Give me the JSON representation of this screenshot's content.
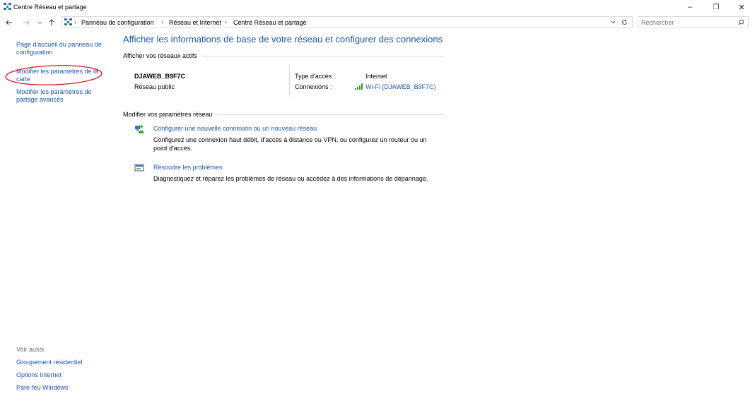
{
  "window": {
    "title": "Centre Réseau et partage",
    "minimize_glyph": "–",
    "restore_glyph": "❐",
    "close_glyph": "✕"
  },
  "nav": {
    "back_icon": "arrow-left-icon",
    "forward_icon": "arrow-right-icon",
    "recent_icon": "chevron-down-icon",
    "up_icon": "arrow-up-icon",
    "breadcrumbs": [
      "Panneau de configuration",
      "Réseau et Internet",
      "Centre Réseau et partage"
    ],
    "separator": "›",
    "search_placeholder": "Rechercher"
  },
  "sidebar": {
    "links": [
      {
        "line1": "Page d'accueil du panneau de",
        "line2": "configuration"
      },
      {
        "line1": "Modifier les paramètres de la",
        "line2": "carte"
      },
      {
        "line1": "Modifier les paramètres de",
        "line2": "partage avancés"
      }
    ],
    "see_also_title": "Voir aussi",
    "see_also": [
      "Groupement résidentiel",
      "Options Internet",
      "Pare-feu Windows"
    ],
    "highlight_color": "#d9141d"
  },
  "main": {
    "title": "Afficher les informations de base de votre réseau et configurer des connexions",
    "active_networks_header": "Afficher vos réseaux actifs",
    "network": {
      "name": "DJAWEB_B9F7C",
      "type": "Réseau public",
      "access_type_label": "Type d'accès :",
      "access_type_value": "Internet",
      "connections_label": "Connexions :",
      "connections_value": "Wi-Fi (DJAWEB_B9F7C)"
    },
    "modify_header": "Modifier vos paramètres réseau",
    "tasks": [
      {
        "icon": "new-connection-icon",
        "title": "Configurer une nouvelle connexion ou un nouveau réseau",
        "desc_line1": "Configurez une connexion haut débit, d'accès à distance ou VPN, ou configurez un routeur ou un",
        "desc_line2": "point d'accès."
      },
      {
        "icon": "troubleshoot-icon",
        "title": "Résoudre les problèmes",
        "desc_line1": "Diagnostiquez et réparez les problèmes de réseau ou accédez à des informations de dépannage."
      }
    ]
  },
  "colors": {
    "link": "#1a56b4",
    "wifi": "#3c9a2e"
  }
}
